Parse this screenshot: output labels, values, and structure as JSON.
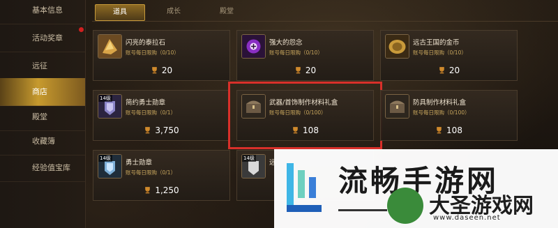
{
  "sidebar": {
    "items": [
      {
        "label": "基本信息"
      },
      {
        "label": "活动奖章"
      },
      {
        "label": "远征"
      },
      {
        "label": "商店"
      },
      {
        "label": "殿堂"
      },
      {
        "label": "收藏簿"
      },
      {
        "label": "经验值宝库"
      }
    ],
    "active_index": 3
  },
  "tabs": [
    {
      "label": "道具"
    },
    {
      "label": "成长"
    },
    {
      "label": "殿堂"
    }
  ],
  "items": [
    {
      "name": "闪亮的泰拉石",
      "limit": "账号每日限购（0/10）",
      "price": "20",
      "icon": "gem-icon"
    },
    {
      "name": "强大的怨念",
      "limit": "账号每日限购（0/10）",
      "price": "20",
      "icon": "purple-orb-icon"
    },
    {
      "name": "远古王国的金币",
      "limit": "账号每日限购（0/10）",
      "price": "20",
      "icon": "gold-coin-icon"
    },
    {
      "name": "简约勇士勋章",
      "limit": "账号每日限购（0/1）",
      "price": "3,750",
      "icon": "medal-icon",
      "badge": "14级"
    },
    {
      "name": "武器/首饰制作材料礼盒",
      "limit": "账号每日限购（0/100）",
      "price": "108",
      "icon": "chest-icon"
    },
    {
      "name": "防具制作材料礼盒",
      "limit": "账号每日限购（0/100）",
      "price": "108",
      "icon": "chest-icon"
    },
    {
      "name": "勇士勋章",
      "limit": "账号每日限购（0/1）",
      "price": "1,250",
      "icon": "medal-icon",
      "badge": "14级"
    },
    {
      "name": "远",
      "limit": "",
      "price": "",
      "icon": "medal-icon",
      "badge": "14级"
    }
  ],
  "watermark": {
    "big": "流畅手游网",
    "brand": "大圣游戏网",
    "url": "www.daseen.net"
  },
  "colors": {
    "accent": "#c79a2e",
    "highlight": "#d9302a"
  }
}
